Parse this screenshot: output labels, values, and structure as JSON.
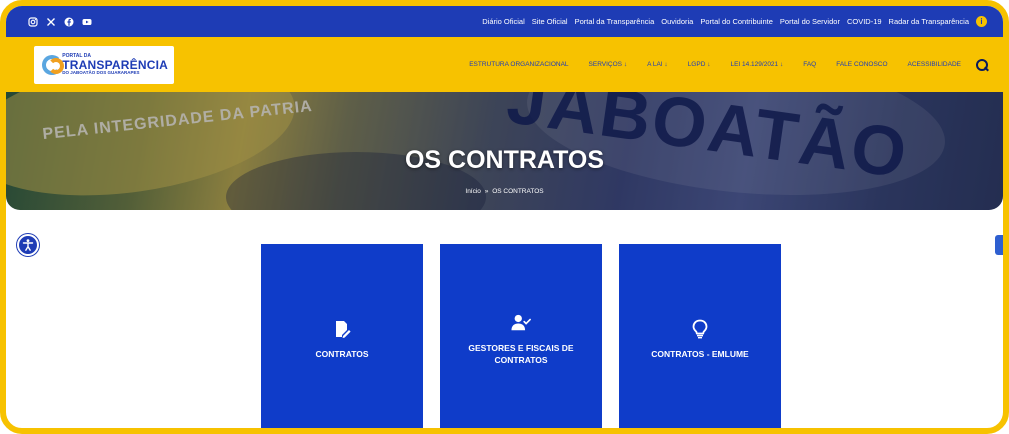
{
  "topbar": {
    "social_icons": [
      "instagram-icon",
      "x-icon",
      "facebook-icon",
      "youtube-icon"
    ],
    "links": [
      "Diário Oficial",
      "Site Oficial",
      "Portal da Transparência",
      "Ouvidoria",
      "Portal do Contribuinte",
      "Portal do Servidor",
      "COVID-19",
      "Radar da Transparência"
    ]
  },
  "logo": {
    "line1": "PORTAL DA",
    "line2": "TRANSPARÊNCIA",
    "line3": "DO JABOATÃO DOS GUARARAPES"
  },
  "nav": {
    "items": [
      "ESTRUTURA ORGANIZACIONAL",
      "SERVIÇOS ↓",
      "A LAI ↓",
      "LGPD ↓",
      "LEI 14.129/2021 ↓",
      "FAQ",
      "FALE CONOSCO",
      "ACESSIBILIDADE"
    ]
  },
  "hero": {
    "title": "OS CONTRATOS",
    "background_text": [
      "PELA INTEGRIDADE DA PATRIA",
      "JABOATÃO"
    ],
    "breadcrumb": {
      "home": "Início",
      "separator": "»",
      "current": "OS CONTRATOS"
    }
  },
  "cards": [
    {
      "label": "CONTRATOS",
      "icon": "edit-document-icon"
    },
    {
      "label": "GESTORES E FISCAIS DE CONTRATOS",
      "icon": "user-check-icon"
    },
    {
      "label": "CONTRATOS - EMLUME",
      "icon": "lightbulb-icon"
    }
  ],
  "colors": {
    "frame": "#f7c200",
    "topbar": "#1e3cb5",
    "navbar": "#f7c200",
    "card": "#0f3cc9"
  }
}
